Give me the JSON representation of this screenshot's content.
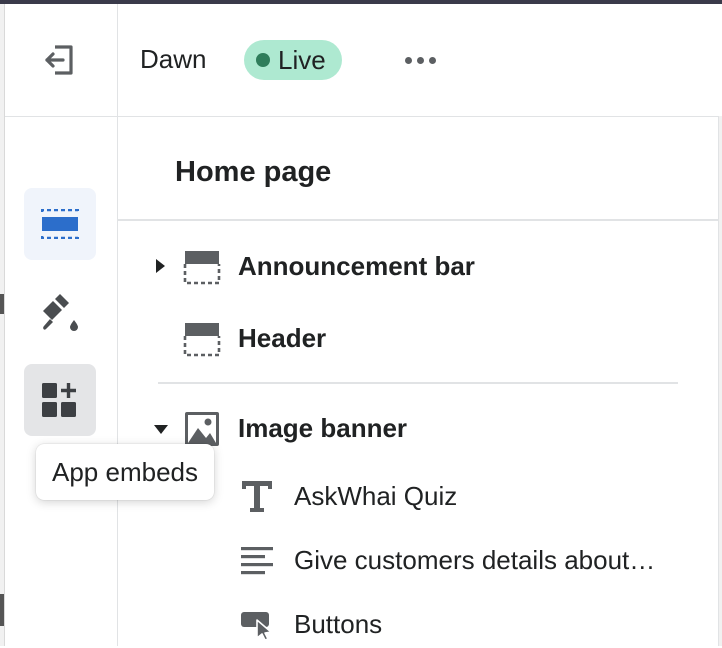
{
  "topbar": {
    "theme_name": "Dawn",
    "status_label": "Live",
    "status_color": "#aee9d1",
    "status_dot_color": "#2f7d5b",
    "more_icon": "horizontal-dots-icon",
    "exit_icon": "exit-icon"
  },
  "rail": {
    "items": [
      {
        "name": "sections",
        "icon": "sections-icon",
        "active": true
      },
      {
        "name": "theme-settings",
        "icon": "paint-brush-icon",
        "active": false
      },
      {
        "name": "app-embeds",
        "icon": "app-embeds-icon",
        "hovered": true
      }
    ],
    "tooltip": "App embeds",
    "accent_color": "#2c6ecb"
  },
  "panel": {
    "title": "Home page",
    "sections": [
      {
        "label": "Announcement bar",
        "icon": "header-layout-icon",
        "expanded": false
      },
      {
        "label": "Header",
        "icon": "header-layout-icon"
      },
      {
        "label": "Image banner",
        "icon": "image-icon",
        "expanded": true,
        "blocks": [
          {
            "label": "AskWhai Quiz",
            "icon": "text-icon"
          },
          {
            "label": "Give customers details about…",
            "icon": "text-align-icon"
          },
          {
            "label": "Buttons",
            "icon": "button-cursor-icon"
          }
        ]
      }
    ]
  }
}
